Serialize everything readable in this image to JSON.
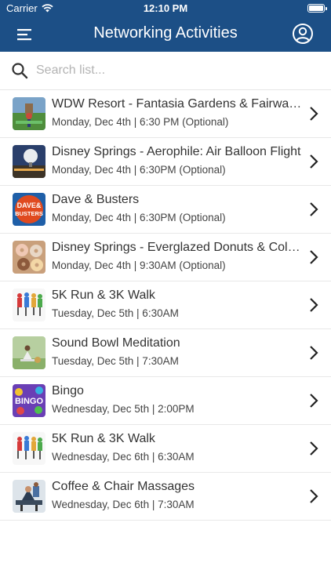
{
  "status_bar": {
    "carrier": "Carrier",
    "time": "12:10 PM"
  },
  "header": {
    "title": "Networking Activities",
    "menu_icon": "hamburger-menu-icon",
    "profile_icon": "user-circle-icon"
  },
  "search": {
    "placeholder": "Search list...",
    "value": ""
  },
  "colors": {
    "header_bg": "#1c4f86",
    "header_text": "#ffffff"
  },
  "activities": [
    {
      "title": "WDW Resort - Fantasia Gardens & Fairway Mini Golf",
      "subtitle": "Monday, Dec 4th | 6:30 PM (Optional)",
      "thumbnail": "mini-golf-thumbnail"
    },
    {
      "title": "Disney Springs - Aerophile: Air Balloon Flight",
      "subtitle": "Monday, Dec 4th | 6:30PM (Optional)",
      "thumbnail": "air-balloon-thumbnail"
    },
    {
      "title": "Dave & Busters",
      "subtitle": "Monday, Dec 4th | 6:30PM (Optional)",
      "thumbnail": "dave-busters-logo-thumbnail",
      "logo_text": "DAVE & BUSTERS"
    },
    {
      "title": "Disney Springs - Everglazed Donuts & Cold Brew",
      "subtitle": "Monday, Dec 4th | 9:30AM (Optional)",
      "thumbnail": "donuts-thumbnail"
    },
    {
      "title": "5K Run & 3K Walk",
      "subtitle": "Tuesday, Dec 5th | 6:30AM",
      "thumbnail": "runners-thumbnail"
    },
    {
      "title": "Sound Bowl Meditation",
      "subtitle": "Tuesday, Dec 5th | 7:30AM",
      "thumbnail": "meditation-thumbnail"
    },
    {
      "title": "Bingo",
      "subtitle": "Wednesday, Dec 5th | 2:00PM",
      "thumbnail": "bingo-thumbnail",
      "logo_text": "BINGO"
    },
    {
      "title": "5K Run & 3K Walk",
      "subtitle": "Wednesday, Dec 6th | 6:30AM",
      "thumbnail": "runners-thumbnail"
    },
    {
      "title": "Coffee & Chair Massages",
      "subtitle": "Wednesday, Dec 6th | 7:30AM",
      "thumbnail": "massage-thumbnail"
    }
  ]
}
